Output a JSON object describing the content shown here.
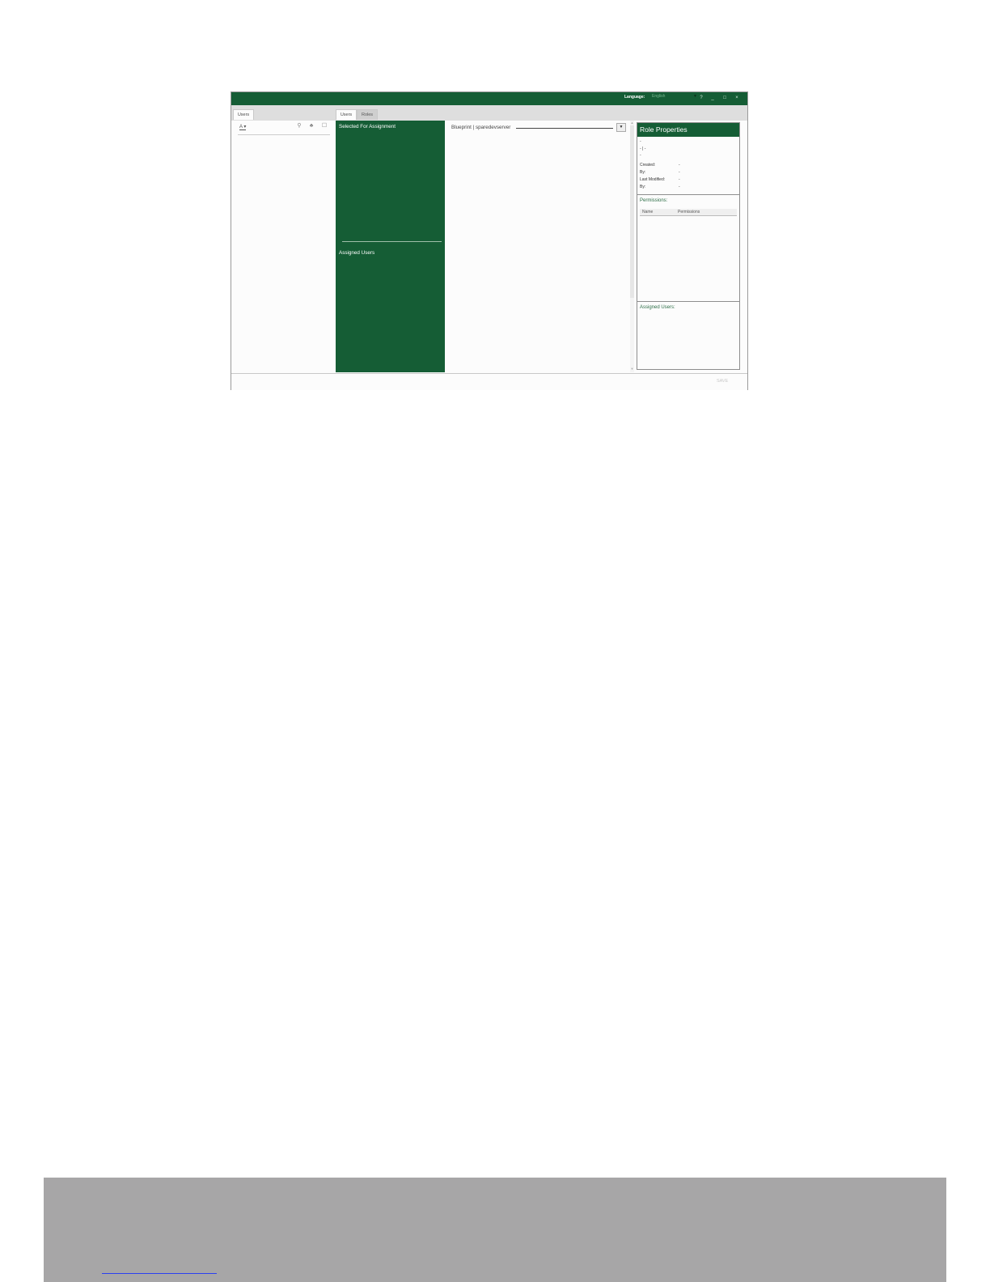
{
  "titlebar": {
    "language_label": "Language:",
    "language_value": "English",
    "buttons": {
      "help": "?",
      "minimize": "_",
      "maximize": "□",
      "close": "×"
    }
  },
  "left_tabs": [
    {
      "label": "Users"
    }
  ],
  "center_tabs": [
    {
      "label": "Users",
      "active": true
    },
    {
      "label": "Roles",
      "active": false
    }
  ],
  "users_panel": {
    "sort_label": "A"
  },
  "assignment_column": {
    "selected_title": "Selected For Assignment",
    "assigned_title": "Assigned Users"
  },
  "blueprint": {
    "label": "Blueprint | sparedevserver"
  },
  "role_properties": {
    "title": "Role Properties",
    "name_value": "-",
    "description_value": "- | -",
    "extra_value": "-",
    "fields": [
      {
        "label": "Created:",
        "value": "-"
      },
      {
        "label": "By:",
        "value": "-"
      },
      {
        "label": "Last Modified:",
        "value": "-"
      },
      {
        "label": "By:",
        "value": "-"
      }
    ],
    "permissions_label": "Permissions:",
    "permissions_columns": [
      "Name",
      "Permissions"
    ],
    "assigned_users_label": "Assigned Users:"
  },
  "statusbar": {
    "save_label": "SAVE"
  },
  "colors": {
    "brand_green": "#155d35",
    "footer_gray": "#a7a6a7",
    "link_blue": "#2b40f0"
  }
}
